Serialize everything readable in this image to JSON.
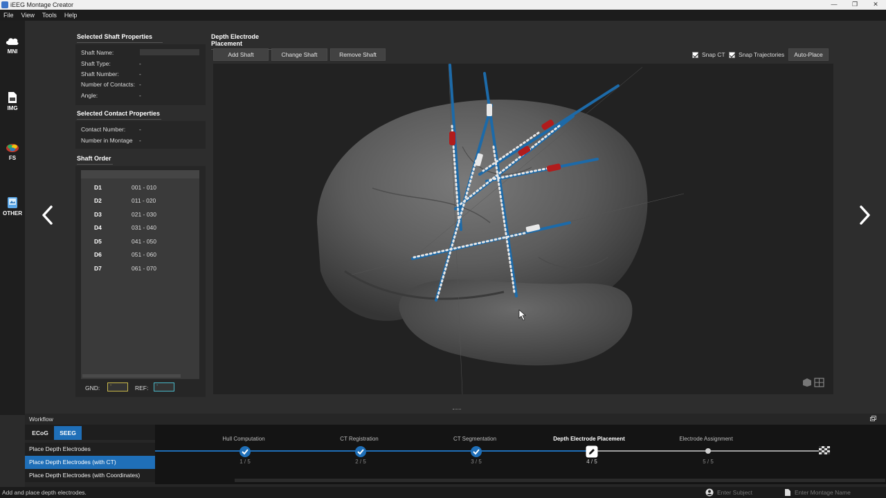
{
  "window": {
    "title": "iEEG Montage Creator",
    "min": "—",
    "max": "❐",
    "close": "✕"
  },
  "menu": [
    "File",
    "View",
    "Tools",
    "Help"
  ],
  "rail": [
    {
      "label": "MNI",
      "icon": "brain-cloud-icon"
    },
    {
      "label": "IMG",
      "icon": "document-icon"
    },
    {
      "label": "FS",
      "icon": "freesurfer-brain-icon"
    },
    {
      "label": "OTHER",
      "icon": "file-stack-icon"
    }
  ],
  "nav": {
    "prev": "‹",
    "next": "›"
  },
  "shaft_props": {
    "title": "Selected Shaft Properties",
    "rows": [
      {
        "label": "Shaft Name:",
        "value": ""
      },
      {
        "label": "Shaft Type:",
        "value": "-"
      },
      {
        "label": "Shaft Number:",
        "value": "-"
      },
      {
        "label": "Number of Contacts:",
        "value": "-"
      },
      {
        "label": "Angle:",
        "value": "-"
      }
    ]
  },
  "contact_props": {
    "title": "Selected Contact Properties",
    "rows": [
      {
        "label": "Contact Number:",
        "value": "-"
      },
      {
        "label": "Number in Montage",
        "value": "-"
      }
    ]
  },
  "shaft_order": {
    "title": "Shaft Order",
    "rows": [
      {
        "name": "D1",
        "range": "001 - 010"
      },
      {
        "name": "D2",
        "range": "011 - 020"
      },
      {
        "name": "D3",
        "range": "021 - 030"
      },
      {
        "name": "D4",
        "range": "031 - 040"
      },
      {
        "name": "D5",
        "range": "041 - 050"
      },
      {
        "name": "D6",
        "range": "051 - 060"
      },
      {
        "name": "D7",
        "range": "061 - 070"
      }
    ],
    "gnd_label": "GND:",
    "ref_label": "REF:",
    "gnd_value": "-",
    "ref_value": "-",
    "gnd_color": "#c8b84a",
    "ref_color": "#4ab8c8"
  },
  "placement": {
    "title": "Depth Electrode Placement",
    "add": "Add Shaft",
    "change": "Change Shaft",
    "remove": "Remove Shaft",
    "snap_ct": "Snap CT",
    "snap_traj": "Snap Trajectories",
    "auto_place": "Auto-Place"
  },
  "workflow": {
    "label": "Workflow",
    "tabs": [
      {
        "label": "ECoG",
        "active": false
      },
      {
        "label": "SEEG",
        "active": true
      }
    ],
    "items": [
      {
        "label": "Place Depth Electrodes",
        "selected": false
      },
      {
        "label": "Place Depth Electrodes (with CT)",
        "selected": true
      },
      {
        "label": "Place Depth Electrodes (with Coordinates)",
        "selected": false
      }
    ],
    "steps": [
      {
        "name": "Hull Computation",
        "num": "1 / 5",
        "state": "done"
      },
      {
        "name": "CT Registration",
        "num": "2 / 5",
        "state": "done"
      },
      {
        "name": "CT Segmentation",
        "num": "3 / 5",
        "state": "done"
      },
      {
        "name": "Depth Electrode Placement",
        "num": "4 / 5",
        "state": "current"
      },
      {
        "name": "Electrode Assignment",
        "num": "5 / 5",
        "state": "pending"
      }
    ],
    "accent": "#1f6fb8"
  },
  "status": {
    "message": "Add and place depth electrodes.",
    "subject_placeholder": "Enter Subject",
    "montage_placeholder": "Enter Montage Name"
  }
}
